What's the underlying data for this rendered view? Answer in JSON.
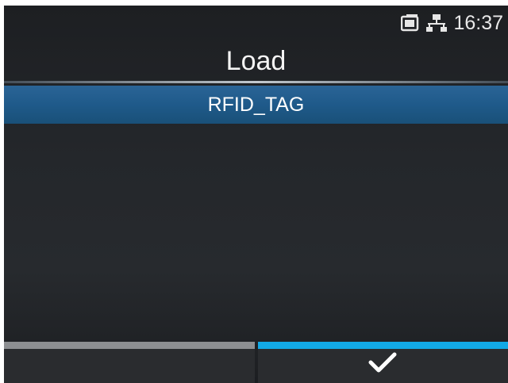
{
  "status": {
    "time": "16:37",
    "icons": [
      "memory-card-icon",
      "network-icon"
    ]
  },
  "screen": {
    "title": "Load"
  },
  "list": {
    "items": [
      {
        "label": "RFID_TAG",
        "selected": true
      }
    ]
  },
  "softkeys": {
    "left": {
      "label": "",
      "bar_color": "#8d8f92"
    },
    "right": {
      "icon": "checkmark-icon",
      "bar_color": "#12a9e6"
    }
  }
}
